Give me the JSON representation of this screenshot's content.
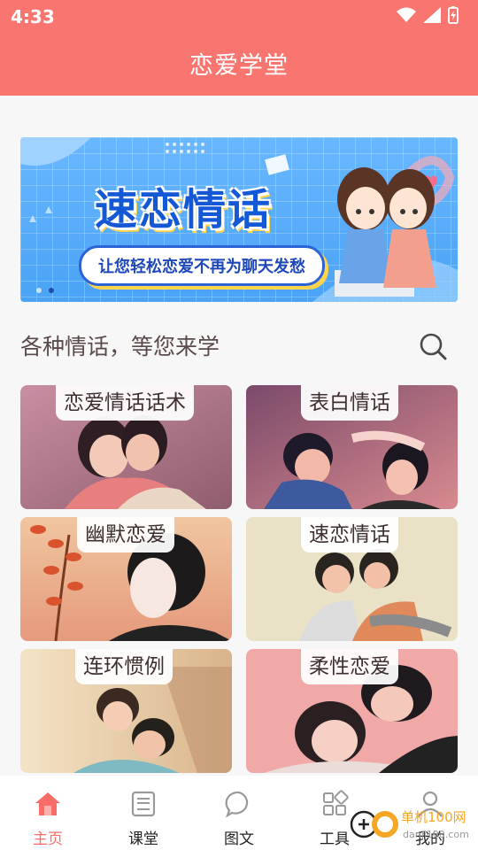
{
  "status_bar": {
    "time": "4:33",
    "icons": [
      "wifi-icon",
      "signal-icon",
      "battery-charging-icon"
    ]
  },
  "header": {
    "title": "恋爱学堂",
    "color": "#f97670"
  },
  "banner": {
    "title": "速恋情话",
    "subtitle": "让您轻松恋爱不再为聊天发愁",
    "page_indicator": {
      "count": 2,
      "active": 2
    }
  },
  "section": {
    "title": "各种情话，等您来学",
    "search_icon": "search-icon"
  },
  "categories": [
    {
      "label": "恋爱情话话术"
    },
    {
      "label": "表白情话"
    },
    {
      "label": "幽默恋爱"
    },
    {
      "label": "速恋情话"
    },
    {
      "label": "连环惯例"
    },
    {
      "label": "柔性恋爱"
    }
  ],
  "tabs": [
    {
      "label": "主页",
      "icon": "home-icon",
      "active": true
    },
    {
      "label": "课堂",
      "icon": "book-icon",
      "active": false
    },
    {
      "label": "图文",
      "icon": "chat-bubble-icon",
      "active": false
    },
    {
      "label": "工具",
      "icon": "grid-tools-icon",
      "active": false
    },
    {
      "label": "我的",
      "icon": "user-icon",
      "active": false
    }
  ],
  "watermark": {
    "text": "单机100网",
    "subtext": "danji100.com"
  },
  "accent_color": "#f96d68"
}
